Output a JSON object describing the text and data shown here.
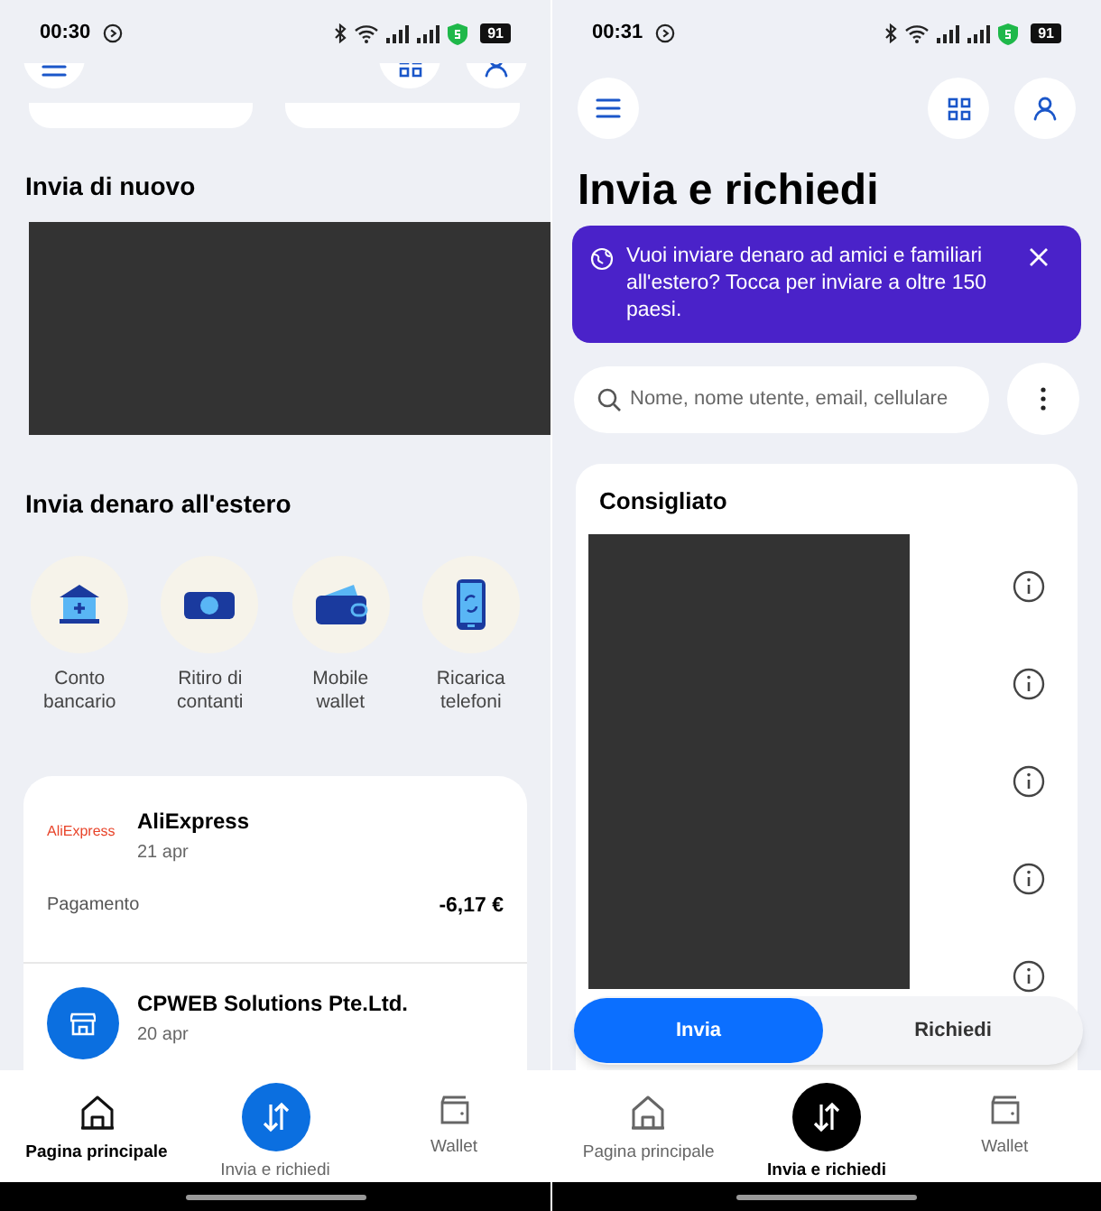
{
  "left_screen": {
    "status_bar": {
      "time": "00:30",
      "battery": "91"
    },
    "send_again": {
      "title": "Invia di nuovo"
    },
    "abroad": {
      "title": "Invia denaro all'estero",
      "options": [
        {
          "kind": "bank",
          "label": "Conto bancario"
        },
        {
          "kind": "cash",
          "label": "Ritiro di contanti"
        },
        {
          "kind": "wallet",
          "label": "Mobile wallet"
        },
        {
          "kind": "phone",
          "label": "Ricarica telefoni"
        }
      ]
    },
    "activity": [
      {
        "kind": "logo",
        "logo": "AliExpress",
        "name": "AliExpress",
        "date": "21 apr",
        "type": "Pagamento",
        "amount": "-6,17 €"
      },
      {
        "kind": "store",
        "name": "CPWEB Solutions Pte.Ltd.",
        "date": "20 apr"
      }
    ],
    "nav": [
      {
        "kind": "home",
        "label": "Pagina principale",
        "selected": true
      },
      {
        "kind": "send",
        "label": "Invia e richiedi",
        "selected": false
      },
      {
        "kind": "wallet",
        "label": "Wallet",
        "selected": false
      }
    ]
  },
  "right_screen": {
    "status_bar": {
      "time": "00:31",
      "battery": "91"
    },
    "title": "Invia e richiedi",
    "banner": {
      "text": "Vuoi inviare denaro ad amici e familiari all'estero? Tocca per inviare a oltre 150 paesi."
    },
    "search": {
      "placeholder": "Nome, nome utente, email, cellulare"
    },
    "recommended": {
      "title": "Consigliato"
    },
    "toggle": [
      {
        "label": "Invia",
        "selected": true
      },
      {
        "label": "Richiedi",
        "selected": false
      }
    ],
    "nav": [
      {
        "kind": "home",
        "label": "Pagina principale",
        "selected": false
      },
      {
        "kind": "send",
        "label": "Invia e richiedi",
        "selected": true
      },
      {
        "kind": "wallet",
        "label": "Wallet",
        "selected": false
      }
    ]
  }
}
